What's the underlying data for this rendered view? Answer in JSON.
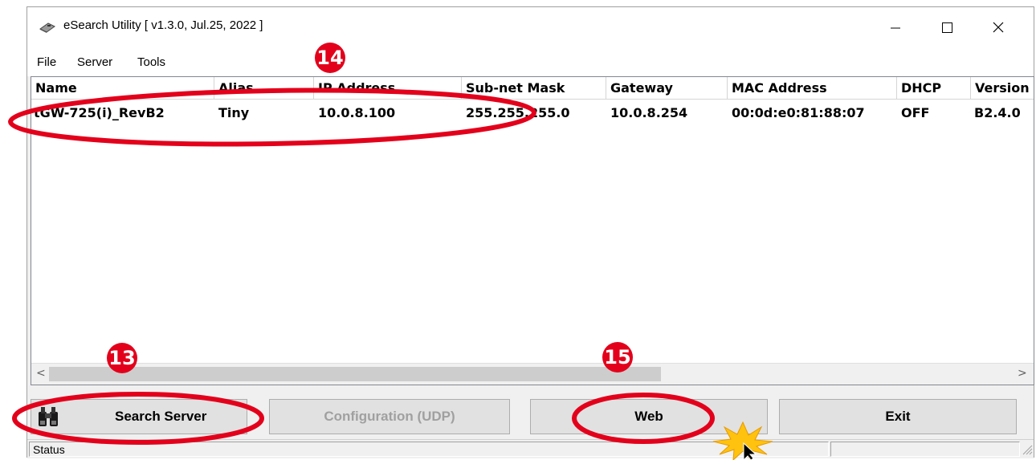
{
  "window": {
    "title": "eSearch Utility [ v1.3.0, Jul.25, 2022 ]",
    "controls": [
      "minimize",
      "maximize",
      "close"
    ]
  },
  "menu": {
    "items": [
      "File",
      "Server",
      "Tools"
    ]
  },
  "table": {
    "columns": [
      "Name",
      "Alias",
      "IP Address",
      "Sub-net Mask",
      "Gateway",
      "MAC Address",
      "DHCP",
      "Version"
    ],
    "rows": [
      [
        "tGW-725(i)_RevB2",
        "Tiny",
        "10.0.8.100",
        "255.255.255.0",
        "10.0.8.254",
        "00:0d:e0:81:88:07",
        "OFF",
        "B2.4.0"
      ]
    ]
  },
  "scrollbar": {
    "left_arrow": "<",
    "right_arrow": ">"
  },
  "buttons": {
    "search_server": "Search Server",
    "configuration": "Configuration (UDP)",
    "web": "Web",
    "exit": "Exit"
  },
  "status": {
    "text": "Status"
  },
  "annotations": {
    "step_search": "13",
    "step_select": "14",
    "step_web": "15"
  },
  "colors": {
    "annotation_red": "#e3001b",
    "burst_yellow": "#ffc20e",
    "button_face": "#e1e1e1",
    "window_bg": "#f0f0f0"
  },
  "icons": [
    "app-icon",
    "minimize-icon",
    "maximize-icon",
    "close-icon",
    "binoculars-icon",
    "mouse-cursor-icon",
    "click-burst-icon",
    "resize-grip-icon"
  ]
}
